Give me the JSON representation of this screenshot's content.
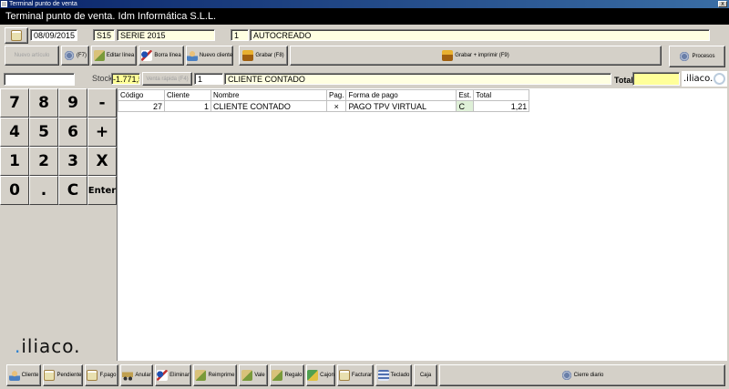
{
  "window": {
    "title": "Terminal punto de venta",
    "close_glyph": "x"
  },
  "header": {
    "title": "Terminal punto de venta. Idm Informática S.L.L."
  },
  "doc": {
    "date": "08/09/2015",
    "series_code": "S15",
    "series_name": "SERIE 2015",
    "number": "1",
    "status": "AUTOCREADO"
  },
  "toolbar": {
    "nuevo_articulo": "Nuevo artículo",
    "f7": "(F7)",
    "editar_linea": "Editar línea",
    "borra_linea": "Borra línea",
    "nuevo_cliente": "Nuevo cliente",
    "grabar": "Grabar (F8)",
    "grabar_imprimir": "Grabar + imprimir (F9)",
    "procesos": "Procesos"
  },
  "line": {
    "search_value": "",
    "stock_label": "Stock",
    "stock_value": "-1.771,5",
    "venta_rapida": "Venta rápida (F4)",
    "client_code": "1",
    "client_name": "CLIENTE CONTADO",
    "total_label": "Total",
    "total_value": ""
  },
  "keypad": {
    "keys": [
      "7",
      "8",
      "9",
      "-",
      "4",
      "5",
      "6",
      "+",
      "1",
      "2",
      "3",
      "X",
      "0",
      ".",
      "C",
      "Enter"
    ]
  },
  "logo": {
    "prefix": ".",
    "left_text": "iliaco.",
    "right_text": ".iliaco."
  },
  "grid": {
    "columns": [
      "Código",
      "Cliente",
      "Nombre",
      "Pag.",
      "Forma de pago",
      "Est.",
      "Total"
    ],
    "rows": [
      [
        "27",
        "1",
        "CLIENTE CONTADO",
        "×",
        "PAGO TPV VIRTUAL",
        "C",
        "1,21"
      ]
    ]
  },
  "bottom": {
    "cliente": "Cliente",
    "pendiente": "Pendiente",
    "fpago": "F.pago",
    "anular": "Anular",
    "eliminar": "Eliminar",
    "reimprime": "Reimprime",
    "vale": "Vale",
    "regalo": "Regalo",
    "cajon": "Cajon",
    "facturar": "Facturar",
    "teclado": "Teclado",
    "caja": "Caja",
    "cierre": "Cierre diario"
  }
}
